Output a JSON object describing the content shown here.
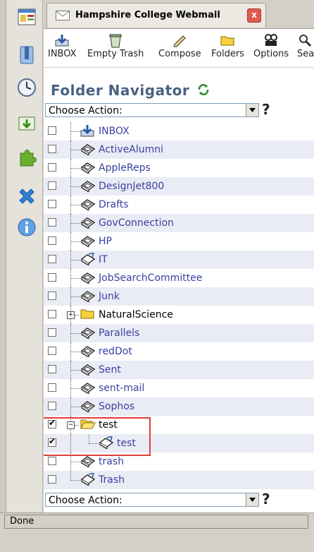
{
  "window": {
    "tab_title": "Hampshire College Webmail",
    "close_label": "x"
  },
  "sidebar": {
    "buttons": [
      {
        "name": "bookmarks-icon"
      },
      {
        "name": "history-icon"
      },
      {
        "name": "downloads-icon"
      },
      {
        "name": "addons-icon"
      },
      {
        "name": "block-icon"
      },
      {
        "name": "info-icon"
      }
    ]
  },
  "toolbar": {
    "items": [
      {
        "label": "INBOX",
        "icon": "inbox-icon"
      },
      {
        "label": "Empty Trash",
        "icon": "empty-trash-icon"
      },
      {
        "label": "Compose",
        "icon": "compose-icon"
      },
      {
        "label": "Folders",
        "icon": "folders-icon"
      },
      {
        "label": "Options",
        "icon": "options-icon"
      },
      {
        "label": "Sea",
        "icon": "search-icon"
      }
    ]
  },
  "navigator": {
    "heading": "Folder Navigator",
    "action_top": "Choose Action:",
    "action_bottom": "Choose Action:",
    "help": "?"
  },
  "folders": [
    {
      "label": "INBOX",
      "checked": false,
      "icon": "inbox"
    },
    {
      "label": "ActiveAlumni",
      "checked": false,
      "icon": "box"
    },
    {
      "label": "AppleReps",
      "checked": false,
      "icon": "box"
    },
    {
      "label": "DesignJet800",
      "checked": false,
      "icon": "box"
    },
    {
      "label": "Drafts",
      "checked": false,
      "icon": "box"
    },
    {
      "label": "GovConnection",
      "checked": false,
      "icon": "box"
    },
    {
      "label": "HP",
      "checked": false,
      "icon": "box"
    },
    {
      "label": "IT",
      "checked": false,
      "icon": "box-new"
    },
    {
      "label": "JobSearchCommittee",
      "checked": false,
      "icon": "box"
    },
    {
      "label": "Junk",
      "checked": false,
      "icon": "box"
    },
    {
      "label": "NaturalScience",
      "checked": false,
      "icon": "folder"
    },
    {
      "label": "Parallels",
      "checked": false,
      "icon": "box"
    },
    {
      "label": "redDot",
      "checked": false,
      "icon": "box"
    },
    {
      "label": "Sent",
      "checked": false,
      "icon": "box"
    },
    {
      "label": "sent-mail",
      "checked": false,
      "icon": "box"
    },
    {
      "label": "Sophos",
      "checked": false,
      "icon": "box"
    },
    {
      "label": "test",
      "checked": true,
      "icon": "folder-open"
    },
    {
      "label": "test",
      "checked": true,
      "icon": "box-new"
    },
    {
      "label": "trash",
      "checked": false,
      "icon": "box"
    },
    {
      "label": "Trash",
      "checked": false,
      "icon": "box-new"
    }
  ],
  "status": {
    "text": "Done"
  },
  "colors": {
    "link": "#3a3fa0",
    "heading": "#4a6282",
    "row_alt": "#eaecf5",
    "highlight": "#e23b3b"
  }
}
